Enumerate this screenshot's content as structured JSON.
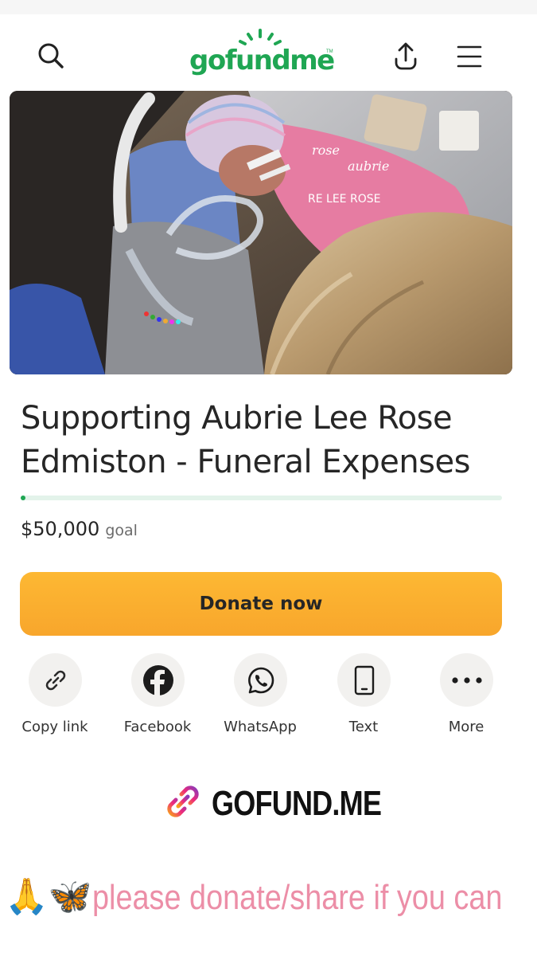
{
  "header": {
    "logo_text": "gofundme",
    "logo_tm": "TM",
    "brand_color": "#1fa653",
    "icons": [
      "search-icon",
      "share-upload-icon",
      "hamburger-menu-icon"
    ]
  },
  "campaign": {
    "title": "Supporting Aubrie Lee Rose Edmiston - Funeral Expenses",
    "goal_amount": "$50,000",
    "goal_label": "goal",
    "progress_fraction": 0.01
  },
  "donate": {
    "label": "Donate now",
    "color": "#f8a62c"
  },
  "share_options": [
    {
      "label": "Copy link",
      "icon": "link-icon"
    },
    {
      "label": "Facebook",
      "icon": "facebook-icon"
    },
    {
      "label": "WhatsApp",
      "icon": "whatsapp-icon"
    },
    {
      "label": "Text",
      "icon": "phone-icon"
    },
    {
      "label": "More",
      "icon": "more-dots-icon"
    }
  ],
  "shortlink": {
    "text": "GOFUND.ME",
    "icon": "link-icon"
  },
  "caption": {
    "emojis": "🙏🦋",
    "text": "please donate/share if you can",
    "color": "#ec8ea7"
  }
}
